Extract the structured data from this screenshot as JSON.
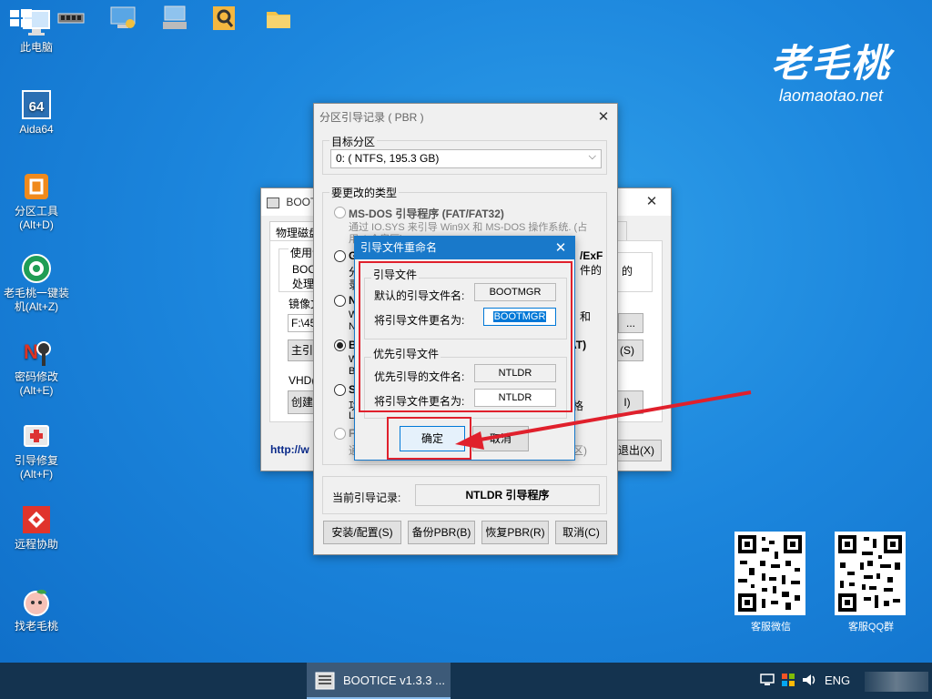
{
  "desktop": {
    "icons": [
      {
        "label": "此电脑",
        "icon": "computer-icon"
      },
      {
        "label": "Aida64",
        "icon": "aida64-icon"
      },
      {
        "label": "分区工具\n(Alt+D)",
        "icon": "partition-tool-icon"
      },
      {
        "label": "老毛桃一键装\n机(Alt+Z)",
        "icon": "installer-icon"
      },
      {
        "label": "密码修改\n(Alt+E)",
        "icon": "password-icon"
      },
      {
        "label": "引导修复\n(Alt+F)",
        "icon": "boot-repair-icon"
      },
      {
        "label": "远程协助",
        "icon": "remote-assist-icon"
      },
      {
        "label": "找老毛桃",
        "icon": "peach-icon"
      }
    ],
    "brand": {
      "name": "老毛桃",
      "url": "laomaotao.net"
    },
    "qr": [
      {
        "label": "客服微信"
      },
      {
        "label": "客服QQ群"
      }
    ]
  },
  "bootice": {
    "title": "BOOTICE",
    "tab": "物理磁盘",
    "l1": "使用说",
    "l2": "BOOT",
    "l3": "处理",
    "l4": "的",
    "l5": "镜像文",
    "path": "F:\\45",
    "main_btn": "主引",
    "ellipsis": "...",
    "s_btn": "(S)",
    "vhd": "VHD(X",
    "create": "创建",
    "i_btn": "I)",
    "link": "http://w",
    "exit": "退出(X)"
  },
  "pbr": {
    "title": "分区引导记录 ( PBR )",
    "target_label": "目标分区",
    "target_value": "0: ( NTFS, 195.3 GB)",
    "type_label": "要更改的类型",
    "msdos": "MS-DOS 引导程序 (FAT/FAT32)",
    "msdos_desc1": "通过 IO.SYS 来引导 Win9X 和 MS-DOS 操作系统. (占",
    "msdos_desc2": "用 4 个扇区)",
    "g_short": "G",
    "exf": "/ExF",
    "zh1": "分",
    "zh2": "录",
    "piece": "件的",
    "nt": "NT",
    "w": "W",
    "nt2": "NT",
    "piece2": "和",
    "bo": "BO",
    "w2": "W",
    "bo2": "BO",
    "at": "AT)",
    "sy": "SY",
    "gong": "功",
    "lir": "Lin",
    "ge": "格",
    "fr": "Fr",
    "tong": "通",
    "region": "区)",
    "current_label": "当前引导记录:",
    "current_value": "NTLDR 引导程序",
    "buttons": [
      "安装/配置(S)",
      "备份PBR(B)",
      "恢复PBR(R)",
      "取消(C)"
    ]
  },
  "rename": {
    "title": "引导文件重命名",
    "group1": "引导文件",
    "default_label": "默认的引导文件名:",
    "default_value": "BOOTMGR",
    "rename_label1": "将引导文件更名为:",
    "rename_value1": "BOOTMGR",
    "group2": "优先引导文件",
    "priority_label": "优先引导的文件名:",
    "priority_value": "NTLDR",
    "rename_label2": "将引导文件更名为:",
    "rename_value2": "NTLDR",
    "ok": "确定",
    "cancel": "取消"
  },
  "taskbar": {
    "active_app": "BOOTICE v1.3.3 ...",
    "lang": "ENG"
  },
  "colors": {
    "highlight": "#e0202c",
    "selection": "#0078d7",
    "accent": "#0078d7"
  }
}
